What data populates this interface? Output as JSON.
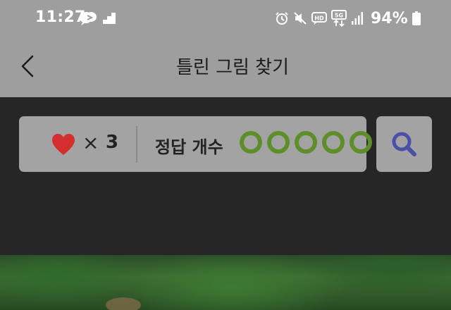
{
  "status_bar": {
    "time": "11:27",
    "battery": "94%",
    "left_icons": [
      "chat-bubble-icon",
      "staircase-icon"
    ],
    "right_icons": [
      "alarm-icon",
      "mute-icon",
      "hd-icon",
      "5g-icon",
      "signal-icon",
      "battery-icon"
    ]
  },
  "header": {
    "title": "틀린 그림 찾기",
    "back_icon": "back-chevron-icon"
  },
  "game": {
    "lives_symbol": "×",
    "lives": "3",
    "answer_label": "정답 개수",
    "answers_total": 5,
    "answers_found": 0,
    "heart_color": "#d32f2f",
    "circle_color": "#5e8e2a",
    "search_icon": "magnifier-icon",
    "search_color": "#4a4fa8"
  },
  "colors": {
    "bar_background": "#9e9e9e",
    "content_background": "#262626",
    "panel_background": "#a3a3a3"
  }
}
